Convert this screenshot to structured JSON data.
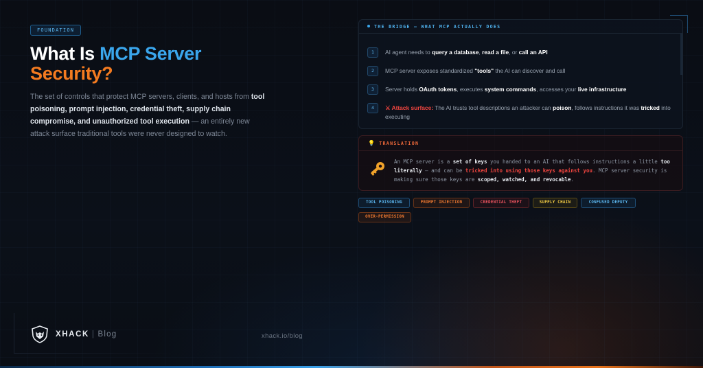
{
  "header": {
    "badge": "FOUNDATION",
    "title_part1": "What Is ",
    "title_part2": "MCP Server",
    "title_part3": "Security?",
    "description": {
      "p1": "The set of controls that protect MCP servers, clients, and hosts from ",
      "b1": "tool poisoning, prompt injection, credential theft, supply chain compromise, and unauthorized tool execution",
      "p2": " — an entirely new attack surface traditional tools were never designed to watch."
    }
  },
  "bridge": {
    "title": "THE BRIDGE — WHAT MCP ACTUALLY DOES",
    "steps": [
      {
        "num": "1",
        "a": "AI agent needs to ",
        "b1": "query a database",
        "c": ", ",
        "b2": "read a file",
        "d": ", or ",
        "b3": "call an API",
        "e": ""
      },
      {
        "num": "2",
        "a": "MCP server exposes standardized ",
        "b1": "\"tools\"",
        "c": " the AI can discover and call",
        "b2": "",
        "d": "",
        "b3": "",
        "e": ""
      },
      {
        "num": "3",
        "a": "Server holds ",
        "b1": "OAuth tokens",
        "c": ", executes ",
        "b2": "system commands",
        "d": ", accesses your ",
        "b3": "live infrastructure",
        "e": ""
      },
      {
        "num": "4",
        "atk": "⚔ Attack surface:",
        "a": " The AI trusts tool descriptions an attacker can ",
        "b1": "poison",
        "c": ", follows instructions it was ",
        "b2": "tricked",
        "d": " into executing",
        "b3": "",
        "e": ""
      }
    ]
  },
  "translation": {
    "title": "TRANSLATION",
    "icon": "key-icon",
    "t1": "An MCP server is a ",
    "b1": "set of keys",
    "t2": " you handed to an AI that follows instructions a little ",
    "b2": "too literally",
    "t3": " — and can be ",
    "r1": "tricked into using those keys against you",
    "t4": ". MCP server security is making sure those keys are ",
    "b3": "scoped, watched, and revocable",
    "t5": "."
  },
  "tags": [
    {
      "label": "TOOL POISONING",
      "color": "#5cb7ef"
    },
    {
      "label": "PROMPT INJECTION",
      "color": "#f07a30"
    },
    {
      "label": "CREDENTIAL THEFT",
      "color": "#f05560"
    },
    {
      "label": "SUPPLY CHAIN",
      "color": "#f2cc44"
    },
    {
      "label": "CONFUSED DEPUTY",
      "color": "#5cb7ef"
    },
    {
      "label": "OVER-PERMISSION",
      "color": "#f07a30"
    }
  ],
  "footer": {
    "brand": "XHACK",
    "separator": "|",
    "section": "Blog",
    "url": "xhack.io/blog",
    "logo_icon": "fox-shield-icon"
  },
  "colors": {
    "accent_blue": "#3aa6ec",
    "accent_orange": "#f47b20",
    "attack_red": "#f0453f"
  }
}
